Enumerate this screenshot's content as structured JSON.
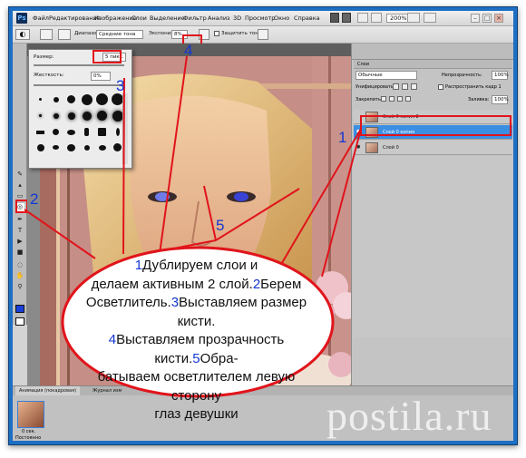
{
  "app": {
    "logo": "Ps"
  },
  "menu": [
    "Файл",
    "Редактирование",
    "Изображение",
    "Слои",
    "Выделение",
    "Фильтр",
    "Анализ",
    "3D",
    "Просмотр",
    "Окно",
    "Справка"
  ],
  "zoom": "200%",
  "options": {
    "range_label": "Диапазон:",
    "range_value": "Средние тона",
    "exposure_label": "Экспонир.:",
    "exposure_value": "8%",
    "protect_label": "Защитить тона"
  },
  "brush_popup": {
    "size_label": "Размер:",
    "size_value": "5 пикс.",
    "hardness_label": "Жесткость:",
    "hardness_value": "0%"
  },
  "layers": {
    "tab": "Слои",
    "blend_mode": "Обычные",
    "opacity_label": "Непрозрачность:",
    "opacity_value": "100%",
    "unify_label": "Унифицировать:",
    "propagate_label": "Распространить кадр 1",
    "lock_label": "Закрепить:",
    "fill_label": "Заливка:",
    "fill_value": "100%",
    "items": [
      {
        "name": "Слой 0 копия 2",
        "selected": false
      },
      {
        "name": "Слой 0 копия",
        "selected": true
      },
      {
        "name": "Слой 0",
        "selected": false
      }
    ]
  },
  "animation": {
    "tab1": "Анимация (покадровая)",
    "tab2": "Журнал изм",
    "frame_time": "0 сек.",
    "loop": "Постоянно"
  },
  "callout": {
    "n1": "1",
    "t1": "Дублируем слои и",
    "t2": "делаем активным 2 слой.",
    "n2": "2",
    "t3": "Берем",
    "t4": "Осветлитель.",
    "n3": "3",
    "t5": "Выставляем размер кисти.",
    "n4": "4",
    "t6": "Выставляем прозрачность кисти.",
    "n5": "5",
    "t7": "Обра-",
    "t8": "батываем осветлителем левую сторону",
    "t9": "глаз девушки"
  },
  "markers": [
    "1",
    "2",
    "3",
    "4",
    "5"
  ],
  "watermark": "postila.ru",
  "colors": {
    "frame": "#1d6fc4",
    "highlight": "#e1141b",
    "numbers": "#1436d4",
    "selected_layer": "#3b8fe3"
  }
}
